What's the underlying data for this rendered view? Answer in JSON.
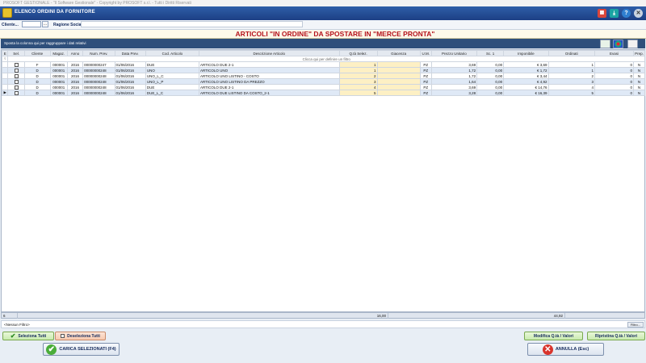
{
  "window_title": "PROSOFT GESTIONALE - \"Il Software Gestionale\" - Copyright by PROSOFT s.r.l. - Tutti i Diritti Riservati",
  "header": {
    "title": "ELENCO ORDINI DA FORNITORE"
  },
  "filters": {
    "cliente_label": "Cliente...",
    "ragione_label": "Ragione Sociale"
  },
  "banner": "ARTICOLI \"IN ORDINE\" DA SPOSTARE IN \"MERCE PRONTA\"",
  "group_panel": "Sposta la colonna qui per raggruppare i dati relativi",
  "filter_row": "Clicca qui per definire un filtro",
  "columns": [
    "Sel.",
    "Cliente",
    "Magaz.",
    "Anno",
    "Num. Prev.",
    "Data Prev.",
    "Cod. Articolo",
    "Descrizione Articolo",
    "Q.tà Selez.",
    "Giacenza",
    "U.M.",
    "Prezzo Unitario",
    "Sc. 1",
    "Imponibile",
    "Ordinati",
    "Evasi",
    "Prep."
  ],
  "rows": [
    {
      "cliente": "F",
      "magaz": "000001",
      "anno": "2016",
      "num": "00000000247",
      "data": "01/06/2016",
      "cod": "DUE",
      "desc": "ARTICOLO DUE 2-1",
      "qty": "1",
      "giac": "",
      "um": "PZ",
      "prezzo": "3,69",
      "sc": "0,00",
      "impon": "€ 3,69",
      "ord": "1",
      "evasi": "0",
      "prep": "N"
    },
    {
      "cliente": "D",
      "magaz": "000001",
      "anno": "2016",
      "num": "00000000248",
      "data": "01/06/2016",
      "cod": "UNO",
      "desc": "ARTICOLO UNO",
      "qty": "1",
      "giac": "",
      "um": "PZ",
      "prezzo": "1,72",
      "sc": "0,00",
      "impon": "€ 1,72",
      "ord": "1",
      "evasi": "0",
      "prep": "N"
    },
    {
      "cliente": "D",
      "magaz": "000001",
      "anno": "2016",
      "num": "00000000248",
      "data": "01/06/2016",
      "cod": "UNO_L_C",
      "desc": "ARTICOLO UNO LISTINO - COSTO",
      "qty": "2",
      "giac": "",
      "um": "PZ",
      "prezzo": "1,72",
      "sc": "0,00",
      "impon": "€ 3,44",
      "ord": "2",
      "evasi": "0",
      "prep": "N"
    },
    {
      "cliente": "D",
      "magaz": "000001",
      "anno": "2016",
      "num": "00000000248",
      "data": "01/06/2016",
      "cod": "UNO_L_P",
      "desc": "ARTICOLO UNO LISTINO DA PREZZO",
      "qty": "3",
      "giac": "",
      "um": "PZ",
      "prezzo": "1,64",
      "sc": "0,00",
      "impon": "€ 4,92",
      "ord": "3",
      "evasi": "0",
      "prep": "N"
    },
    {
      "cliente": "D",
      "magaz": "000001",
      "anno": "2016",
      "num": "00000000248",
      "data": "01/06/2016",
      "cod": "DUE",
      "desc": "ARTICOLO DUE 2-1",
      "qty": "4",
      "giac": "",
      "um": "PZ",
      "prezzo": "3,69",
      "sc": "0,00",
      "impon": "€ 14,76",
      "ord": "4",
      "evasi": "0",
      "prep": "N"
    },
    {
      "cliente": "D",
      "magaz": "000001",
      "anno": "2016",
      "num": "00000000248",
      "data": "01/06/2016",
      "cod": "DUE_L_C",
      "desc": "ARTICOLO DUE LISTINO DA COSTO_2-1",
      "qty": "5",
      "giac": "",
      "um": "PZ",
      "prezzo": "3,28",
      "sc": "0,00",
      "impon": "€ 16,39",
      "ord": "5",
      "evasi": "0",
      "prep": "N"
    }
  ],
  "footer": {
    "count": "6",
    "qty_total": "16,00",
    "impon_total": "44,92"
  },
  "status": {
    "text": "<Nessun Filtro>",
    "filtro_button": "Filtro..."
  },
  "buttons": {
    "select_all": "Seleziona Tutti",
    "deselect_all": "Deseleziona Tutti",
    "modify_qty": "Modifica Q.tà / Valori",
    "restore_qty": "Ripristina Q.tà / Valori",
    "load_selected": "CARICA SELEZIONATI (F4)",
    "cancel": "ANNULLA (Esc)"
  }
}
